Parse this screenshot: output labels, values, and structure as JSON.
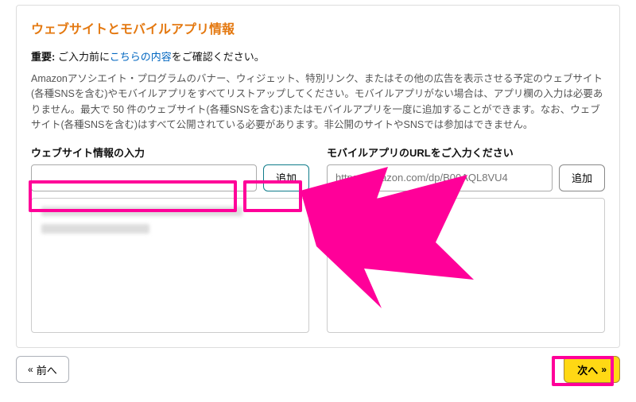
{
  "card": {
    "title": "ウェブサイトとモバイルアプリ情報",
    "important_label": "重要:",
    "important_before": " ご入力前に",
    "important_link": "こちらの内容",
    "important_after": "をご確認ください。",
    "description": "Amazonアソシエイト・プログラムのバナー、ウィジェット、特別リンク、またはその他の広告を表示させる予定のウェブサイト(各種SNSを含む)やモバイルアプリをすべてリストアップしてください。モバイルアプリがない場合は、アプリ欄の入力は必要ありません。最大で 50 件のウェブサイト(各種SNSを含む)またはモバイルアプリを一度に追加することができます。なお、ウェブサイト(各種SNSを含む)はすべて公開されている必要があります。非公開のサイトやSNSでは参加はできません。"
  },
  "left": {
    "label": "ウェブサイト情報の入力",
    "input_value": "",
    "add_label": "追加"
  },
  "right": {
    "label": "モバイルアプリのURLをご入力ください",
    "placeholder": "https://amazon.com/dp/B00AQL8VU4",
    "add_label": "追加"
  },
  "nav": {
    "prev": "前へ",
    "next": "次へ"
  }
}
